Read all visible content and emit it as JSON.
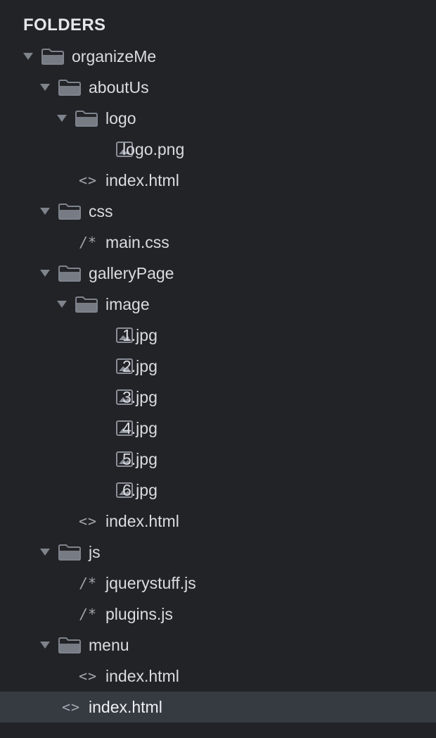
{
  "sidebar": {
    "section_title": "FOLDERS",
    "items": [
      {
        "label": "organizeMe",
        "kind": "folder",
        "icon": "folder-icon",
        "depth": 0,
        "expanded": true
      },
      {
        "label": "aboutUs",
        "kind": "folder",
        "icon": "folder-icon",
        "depth": 1,
        "expanded": true
      },
      {
        "label": "logo",
        "kind": "folder",
        "icon": "folder-icon",
        "depth": 2,
        "expanded": true
      },
      {
        "label": "logo.png",
        "kind": "image",
        "icon": "image-icon",
        "depth": 3
      },
      {
        "label": "index.html",
        "kind": "markup",
        "icon": "code-icon",
        "icon_text": "<>",
        "depth": 2
      },
      {
        "label": "css",
        "kind": "folder",
        "icon": "folder-icon",
        "depth": 1,
        "expanded": true
      },
      {
        "label": "main.css",
        "kind": "script",
        "icon": "comment-icon",
        "icon_text": "/*",
        "depth": 2
      },
      {
        "label": "galleryPage",
        "kind": "folder",
        "icon": "folder-icon",
        "depth": 1,
        "expanded": true
      },
      {
        "label": "image",
        "kind": "folder",
        "icon": "folder-icon",
        "depth": 2,
        "expanded": true
      },
      {
        "label": "1.jpg",
        "kind": "image",
        "icon": "image-icon",
        "depth": 3
      },
      {
        "label": "2.jpg",
        "kind": "image",
        "icon": "image-icon",
        "depth": 3
      },
      {
        "label": "3.jpg",
        "kind": "image",
        "icon": "image-icon",
        "depth": 3
      },
      {
        "label": "4.jpg",
        "kind": "image",
        "icon": "image-icon",
        "depth": 3
      },
      {
        "label": "5.jpg",
        "kind": "image",
        "icon": "image-icon",
        "depth": 3
      },
      {
        "label": "6.jpg",
        "kind": "image",
        "icon": "image-icon",
        "depth": 3
      },
      {
        "label": "index.html",
        "kind": "markup",
        "icon": "code-icon",
        "icon_text": "<>",
        "depth": 2
      },
      {
        "label": "js",
        "kind": "folder",
        "icon": "folder-icon",
        "depth": 1,
        "expanded": true
      },
      {
        "label": "jquerystuff.js",
        "kind": "script",
        "icon": "comment-icon",
        "icon_text": "/*",
        "depth": 2
      },
      {
        "label": "plugins.js",
        "kind": "script",
        "icon": "comment-icon",
        "icon_text": "/*",
        "depth": 2
      },
      {
        "label": "menu",
        "kind": "folder",
        "icon": "folder-icon",
        "depth": 1,
        "expanded": true
      },
      {
        "label": "index.html",
        "kind": "markup",
        "icon": "code-icon",
        "icon_text": "<>",
        "depth": 2
      },
      {
        "label": "index.html",
        "kind": "markup",
        "icon": "code-icon",
        "icon_text": "<>",
        "depth": 1,
        "selected": true
      }
    ]
  },
  "colors": {
    "background": "#212327",
    "selected_row": "#363a41",
    "text": "#d9dce1",
    "icon": "#8a8f98"
  }
}
